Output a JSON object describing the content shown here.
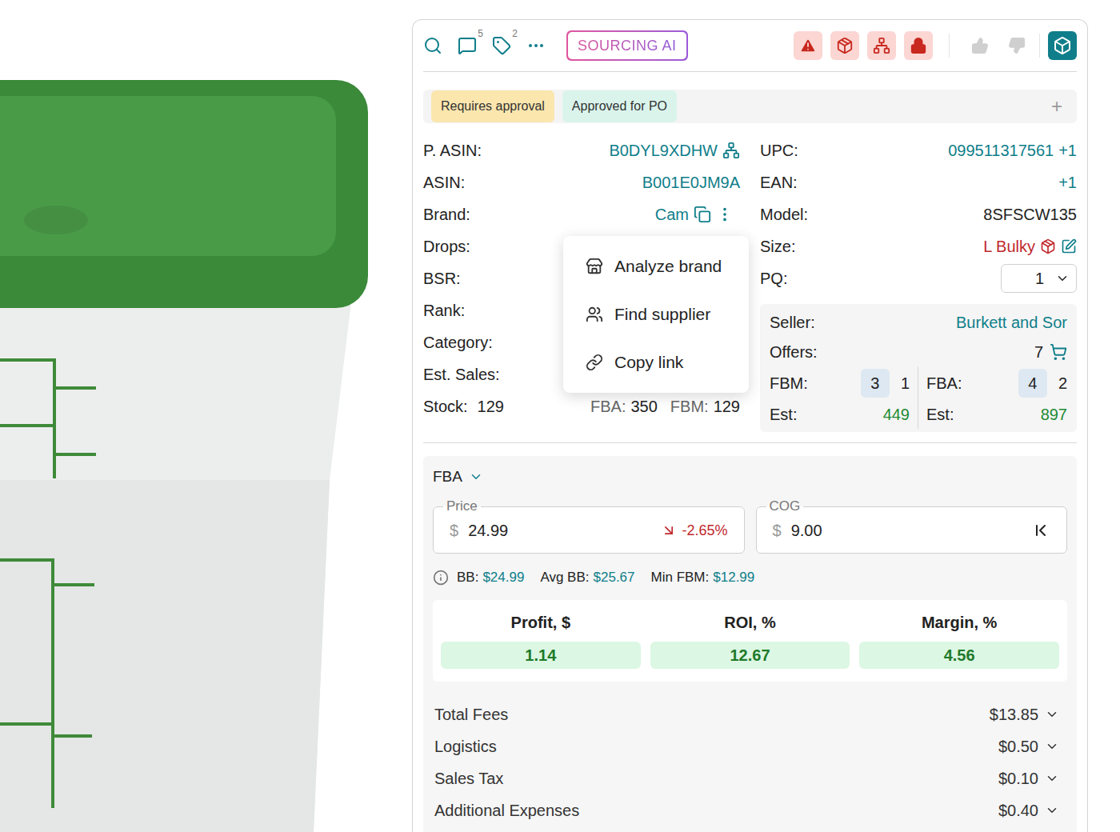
{
  "toolbar": {
    "tools": [
      {
        "kind": "search"
      },
      {
        "kind": "comments",
        "count": "5"
      },
      {
        "kind": "tags",
        "count": "2"
      },
      {
        "kind": "more"
      }
    ],
    "sourcing_button": "SOURCING AI",
    "flags": [
      {
        "kind": "warning"
      },
      {
        "kind": "package"
      },
      {
        "kind": "variations"
      },
      {
        "kind": "restricted"
      }
    ],
    "votes": [
      {
        "kind": "up",
        "disabled": true
      },
      {
        "kind": "down",
        "disabled": true
      }
    ],
    "app_button": {
      "kind": "cube",
      "selected": true
    }
  },
  "tags": {
    "items": [
      {
        "label": "Requires approval",
        "color": "#fbe6ae"
      },
      {
        "label": "Approved for PO",
        "color": "#daf4ec"
      }
    ],
    "add": "+"
  },
  "product": {
    "left": [
      {
        "label": "P. ASIN:",
        "value": "B0DYL9XDHW",
        "kind": "parent"
      },
      {
        "label": "ASIN:",
        "value": "B001E0JM9A",
        "kind": "link"
      },
      {
        "label": "Brand:",
        "value": "Cam",
        "kind": "brand"
      },
      {
        "label": "Drops:",
        "value": "",
        "kind": "plain"
      },
      {
        "label": "BSR:",
        "value": "",
        "kind": "plain"
      },
      {
        "label": "Rank:",
        "value": "",
        "kind": "plain"
      },
      {
        "label": "Category:",
        "value": "",
        "kind": "plain"
      },
      {
        "label": "Est. Sales:",
        "value": "",
        "kind": "plain"
      }
    ],
    "stock": {
      "label": "Stock:",
      "value": "129",
      "fba_label": "FBA:",
      "fba": "350",
      "fbm_label": "FBM:",
      "fbm": "129"
    },
    "brand_menu": {
      "open": true,
      "items": [
        {
          "label": "Analyze brand",
          "kind": "analyze"
        },
        {
          "label": "Find supplier",
          "kind": "supplier"
        },
        {
          "label": "Copy link",
          "kind": "link"
        }
      ]
    },
    "right": [
      {
        "label": "UPC:",
        "value": "099511317561",
        "extra": "+1",
        "kind": "link"
      },
      {
        "label": "EAN:",
        "value": "",
        "extra": "+1",
        "kind": "link"
      },
      {
        "label": "Model:",
        "value": "8SFSCW135",
        "extra": "",
        "kind": "plain"
      },
      {
        "label": "Size:",
        "value": "L Bulky",
        "extra": "",
        "kind": "size"
      }
    ],
    "pq": {
      "label": "PQ:",
      "value": "1"
    },
    "offers": {
      "seller_label": "Seller:",
      "seller": "Burkett and Sor",
      "offers_label": "Offers:",
      "offers": "7",
      "fbm": {
        "label": "FBM:",
        "badge": "3",
        "count": "1",
        "est_label": "Est:",
        "est": "449"
      },
      "fba": {
        "label": "FBA:",
        "badge": "4",
        "count": "2",
        "est_label": "Est:",
        "est": "897"
      }
    }
  },
  "calculator": {
    "mode": "FBA",
    "price": {
      "label": "Price",
      "currency": "$",
      "value": "24.99",
      "change": "-2.65%",
      "trend": "down"
    },
    "cog": {
      "label": "COG",
      "currency": "$",
      "value": "9.00"
    },
    "info": [
      {
        "label": "BB:",
        "value": "$24.99"
      },
      {
        "label": "Avg BB:",
        "value": "$25.67"
      },
      {
        "label": "Min FBM:",
        "value": "$12.99"
      }
    ],
    "metrics": [
      {
        "label": "Profit, $",
        "value": "1.14",
        "color": "#dcf7e3"
      },
      {
        "label": "ROI, %",
        "value": "12.67",
        "color": "#dcf7e3"
      },
      {
        "label": "Margin, %",
        "value": "4.56",
        "color": "#dcf7e3"
      }
    ],
    "costs": [
      {
        "label": "Total Fees",
        "value": "$13.85",
        "expanded": false
      },
      {
        "label": "Logistics",
        "value": "$0.50",
        "expanded": false
      },
      {
        "label": "Sales Tax",
        "value": "$0.10",
        "expanded": false
      },
      {
        "label": "Additional Expenses",
        "value": "$0.40",
        "expanded": false
      }
    ]
  }
}
